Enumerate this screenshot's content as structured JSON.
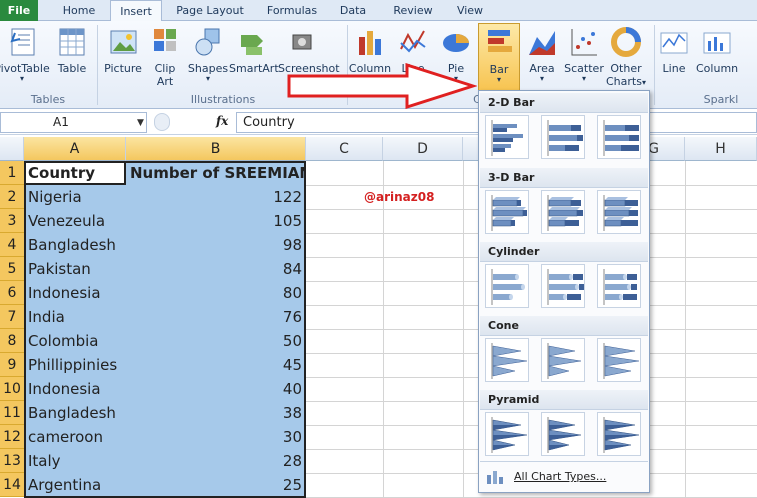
{
  "tabs": [
    "File",
    "Home",
    "Insert",
    "Page Layout",
    "Formulas",
    "Data",
    "Review",
    "View"
  ],
  "active_tab": "Insert",
  "ribbon": {
    "tables": {
      "pivottable": "PivotTable",
      "table": "Table",
      "group": "Tables"
    },
    "illustrations": {
      "picture": "Picture",
      "clip_art_1": "Clip",
      "clip_art_2": "Art",
      "shapes": "Shapes",
      "smartart": "SmartArt",
      "screenshot": "Screenshot",
      "group": "Illustrations"
    },
    "charts": {
      "column": "Column",
      "line": "Line",
      "pie": "Pie",
      "bar": "Bar",
      "area": "Area",
      "scatter": "Scatter",
      "other_1": "Other",
      "other_2": "Charts",
      "group": "C"
    },
    "sparklines": {
      "line": "Line",
      "column": "Column",
      "group": "Sparkl"
    }
  },
  "formula_bar": {
    "name_box": "A1",
    "fx": "fx",
    "value": "Country"
  },
  "columns": [
    "A",
    "B",
    "C",
    "D",
    "E",
    "F",
    "G",
    "H"
  ],
  "rows": [
    "1",
    "2",
    "3",
    "4",
    "5",
    "6",
    "7",
    "8",
    "9",
    "10",
    "11",
    "12",
    "13",
    "14"
  ],
  "table": {
    "headers": [
      "Country",
      "Number of SREEMIANS"
    ],
    "rows": [
      [
        "Nigeria",
        "122"
      ],
      [
        "Venezeula",
        "105"
      ],
      [
        "Bangladesh",
        "98"
      ],
      [
        "Pakistan",
        "84"
      ],
      [
        "Indonesia",
        "80"
      ],
      [
        "India",
        "76"
      ],
      [
        "Colombia",
        "50"
      ],
      [
        "Phillippinies",
        "45"
      ],
      [
        "Indonesia",
        "40"
      ],
      [
        "Bangladesh",
        "38"
      ],
      [
        "cameroon",
        "30"
      ],
      [
        "Italy",
        "28"
      ],
      [
        "Argentina",
        "25"
      ]
    ]
  },
  "watermark": "@arinaz08",
  "bar_dropdown": {
    "sections": [
      "2-D Bar",
      "3-D Bar",
      "Cylinder",
      "Cone",
      "Pyramid"
    ],
    "all_chart_types": "All Chart Types..."
  },
  "colors": {
    "accent_selection": "#a6c9ea",
    "header_highlight": "#f4c75f",
    "file_tab": "#2a8a3e",
    "arrow": "#e02020"
  }
}
